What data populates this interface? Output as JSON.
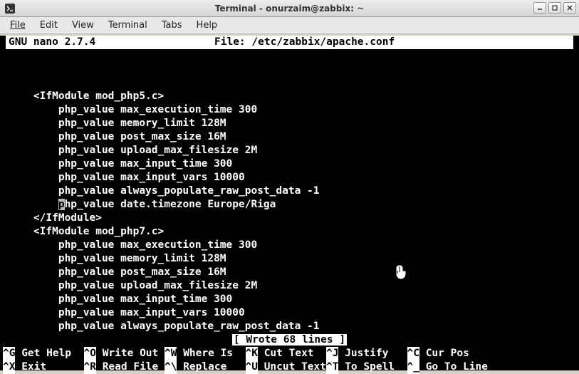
{
  "window": {
    "title": "Terminal - onurzaim@zabbix: ~"
  },
  "menu": {
    "file": "File",
    "edit": "Edit",
    "view": "View",
    "terminal": "Terminal",
    "tabs": "Tabs",
    "help": "Help"
  },
  "nano": {
    "version": "GNU nano 2.7.4",
    "file_label": "File: /etc/zabbix/apache.conf",
    "status": "[ Wrote 68 lines ]"
  },
  "content": {
    "l01": "",
    "l02": "    <IfModule mod_php5.c>",
    "l03": "        php_value max_execution_time 300",
    "l04": "        php_value memory_limit 128M",
    "l05": "        php_value post_max_size 16M",
    "l06": "        php_value upload_max_filesize 2M",
    "l07": "        php_value max_input_time 300",
    "l08": "        php_value max_input_vars 10000",
    "l09": "        php_value always_populate_raw_post_data -1",
    "l10a": "        ",
    "l10b": "p",
    "l10c": "hp_value date.timezone Europe/Riga",
    "l11": "    </IfModule>",
    "l12": "    <IfModule mod_php7.c>",
    "l13": "        php_value max_execution_time 300",
    "l14": "        php_value memory_limit 128M",
    "l15": "        php_value post_max_size 16M",
    "l16": "        php_value upload_max_filesize 2M",
    "l17": "        php_value max_input_time 300",
    "l18": "        php_value max_input_vars 10000",
    "l19": "        php_value always_populate_raw_post_data -1"
  },
  "shortcuts": {
    "r1": {
      "k1": "^G",
      "t1": " Get Help  ",
      "k2": "^O",
      "t2": " Write Out ",
      "k3": "^W",
      "t3": " Where Is  ",
      "k4": "^K",
      "t4": " Cut Text  ",
      "k5": "^J",
      "t5": " Justify   ",
      "k6": "^C",
      "t6": " Cur Pos"
    },
    "r2": {
      "k1": "^X",
      "t1": " Exit      ",
      "k2": "^R",
      "t2": " Read File ",
      "k3": "^\\",
      "t3": " Replace   ",
      "k4": "^U",
      "t4": " Uncut Text",
      "k5": "^T",
      "t5": " To Spell  ",
      "k6": "^_",
      "t6": " Go To Line"
    }
  }
}
